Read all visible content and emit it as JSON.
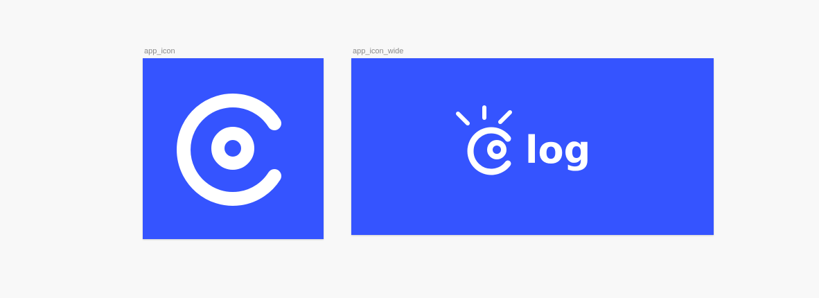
{
  "canvas": {
    "background": "#f8f8f8"
  },
  "frames": [
    {
      "label": "app_icon",
      "background": "#3554ff",
      "content": {
        "logo_icon": "c-ring-eye-icon",
        "color": "#ffffff"
      }
    },
    {
      "label": "app_icon_wide",
      "background": "#3554ff",
      "content": {
        "logo_icon": "c-ring-eye-with-rays-icon",
        "wordmark": "log",
        "color": "#ffffff"
      }
    }
  ]
}
